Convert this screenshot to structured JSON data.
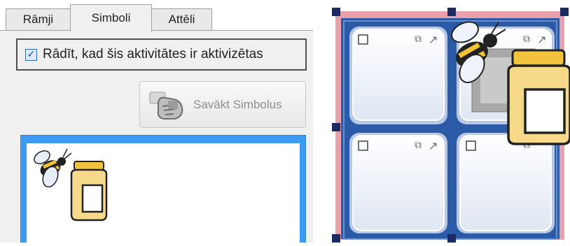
{
  "tabs": [
    "Rāmji",
    "Simboli",
    "Attēli"
  ],
  "active_tab": "Simboli",
  "activation_checkbox": {
    "label": "Rādīt, kad šis aktivitātes ir aktivizētas",
    "checked": true
  },
  "collect_button": {
    "label": "Savākt Simbolus",
    "icon": "hand-grab-icon",
    "enabled": false
  },
  "preview": {
    "symbols": [
      "bee-icon",
      "honey-jar-icon"
    ]
  },
  "canvas": {
    "cells": 4,
    "symbols": [
      "bee-icon",
      "honey-jar-icon"
    ],
    "colors": {
      "frame": "#e27a87",
      "panel": "#2b5aa6",
      "handle": "#1b2a63"
    }
  }
}
